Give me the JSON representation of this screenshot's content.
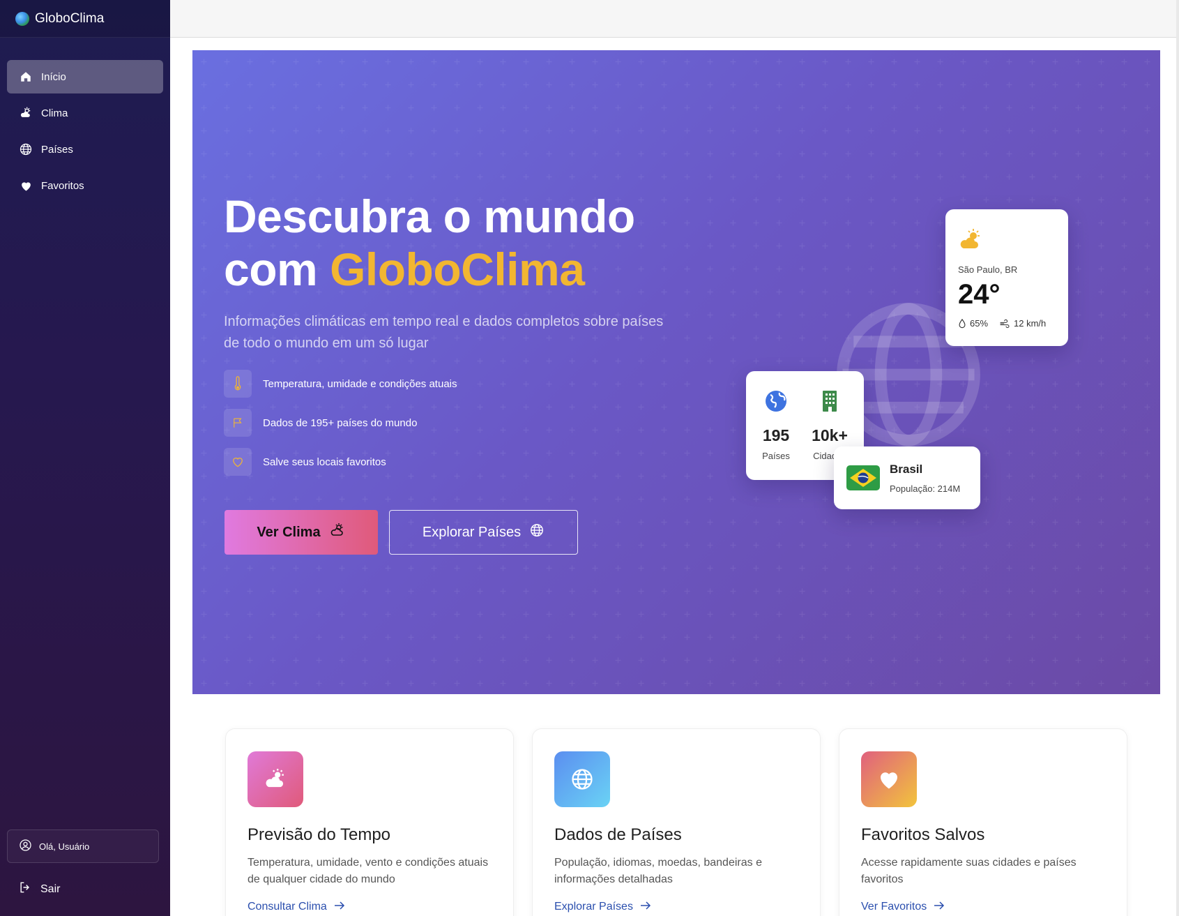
{
  "app": {
    "name": "GloboClima"
  },
  "sidebar": {
    "items": [
      {
        "label": "Início",
        "icon": "home-icon",
        "active": true
      },
      {
        "label": "Clima",
        "icon": "weather-icon",
        "active": false
      },
      {
        "label": "Países",
        "icon": "globe-icon",
        "active": false
      },
      {
        "label": "Favoritos",
        "icon": "heart-icon",
        "active": false
      }
    ],
    "user_label": "Olá, Usuário",
    "logout_label": "Sair"
  },
  "hero": {
    "title_line1": "Descubra o mundo",
    "title_prefix": "com",
    "title_accent": "GloboClima",
    "subtitle": "Informações climáticas em tempo real e dados completos sobre países de todo o mundo em um só lugar",
    "features": [
      {
        "label": "Temperatura, umidade e condições atuais",
        "icon": "thermometer-icon"
      },
      {
        "label": "Dados de 195+ países do mundo",
        "icon": "flag-icon"
      },
      {
        "label": "Salve seus locais favoritos",
        "icon": "heart-outline-icon"
      }
    ],
    "primary_button": "Ver Clima",
    "secondary_button": "Explorar Países",
    "accent_color": "#f2b631"
  },
  "weather_card": {
    "city": "São Paulo, BR",
    "temperature": "24°",
    "humidity": "65%",
    "wind": "12 km/h"
  },
  "stats_card": {
    "countries_value": "195",
    "countries_label": "Países",
    "cities_value": "10k+",
    "cities_label": "Cidades"
  },
  "country_card": {
    "name": "Brasil",
    "population": "População: 214M"
  },
  "feature_cards": [
    {
      "title": "Previsão do Tempo",
      "description": "Temperatura, umidade, vento e condições atuais de qualquer cidade do mundo",
      "link": "Consultar Clima"
    },
    {
      "title": "Dados de Países",
      "description": "População, idiomas, moedas, bandeiras e informações detalhadas",
      "link": "Explorar Países"
    },
    {
      "title": "Favoritos Salvos",
      "description": "Acesse rapidamente suas cidades e países favoritos",
      "link": "Ver Favoritos"
    }
  ]
}
